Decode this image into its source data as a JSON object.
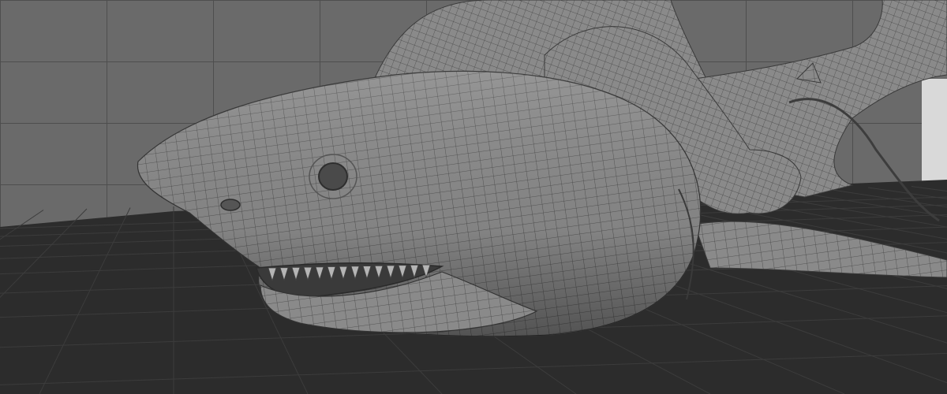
{
  "viewport": {
    "view_mode": "wireframe-on-shaded",
    "background": {
      "wall_color": "#6a6a6a",
      "wall_grid_color": "#4e4e4e",
      "floor_color": "#2c2c2c",
      "floor_grid_color": "#3c3c3c",
      "light_panel_color": "#d9d9d9"
    },
    "model": {
      "subject": "shark-with-rider",
      "shaded_color": "#8a8a8a",
      "wire_color": "#444444",
      "tooth_color": "#b5b5b5",
      "mouth_color": "#3a3a3a"
    }
  }
}
